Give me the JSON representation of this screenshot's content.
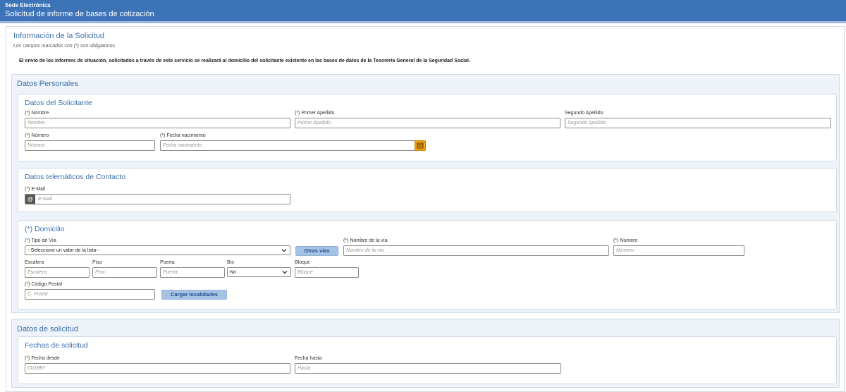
{
  "header": {
    "site": "Sede Electrónica",
    "title": "Solicitud de informe de bases de cotización"
  },
  "info": {
    "title": "Información de la Solicitud",
    "required_note": "Los campos marcados con (*) son obligatorios.",
    "notice": "El envío de los informes de situación, solicitados a través de este servicio se realizará al domicilio del solicitante existente en las bases de datos de la Tesorería General de la Seguridad Social."
  },
  "personal": {
    "section_title": "Datos Personales",
    "solicitante": {
      "title": "Datos del Solicitante",
      "nombre": {
        "label": "(*) Nombre",
        "placeholder": "Nombre"
      },
      "primer_apellido": {
        "label": "(*) Primer Apellido",
        "placeholder": "Primer Apellido"
      },
      "segundo_apellido": {
        "label": "Segundo Apellido",
        "placeholder": "Segundo Apellido"
      },
      "numero": {
        "label": "(*) Número",
        "placeholder": "Número"
      },
      "fecha_nacimiento": {
        "label": "(*) Fecha nacimiento",
        "placeholder": "Fecha nacimiento"
      },
      "calendar_icon": "calendar-icon"
    },
    "contacto": {
      "title": "Datos telemáticos de Contacto",
      "email": {
        "label": "(*) E-Mail",
        "placeholder": "E-Mail",
        "addon": "@"
      }
    },
    "domicilio": {
      "title": "(*) Domicilio",
      "tipo_via": {
        "label": "(*) Tipo de Vía",
        "value": "--Seleccione un valor de la lista--"
      },
      "otras_vias_button": "Otras vías",
      "nombre_via": {
        "label": "(*) Nombre de la vía",
        "placeholder": "Nombre de la vía"
      },
      "numero": {
        "label": "(*) Número",
        "placeholder": "Número"
      },
      "escalera": {
        "label": "Escalera",
        "placeholder": "Escalera"
      },
      "piso": {
        "label": "Piso",
        "placeholder": "Piso"
      },
      "puerta": {
        "label": "Puerta",
        "placeholder": "Puerta"
      },
      "bis": {
        "label": "Bis",
        "value": "No"
      },
      "bloque": {
        "label": "Bloque",
        "placeholder": "Bloque"
      },
      "codigo_postal": {
        "label": "(*) Código Postal",
        "placeholder": "C. Postal"
      },
      "cargar_localidades_button": "Cargar localidades"
    }
  },
  "solicitud": {
    "section_title": "Datos de solicitud",
    "fechas": {
      "title": "Fechas de solicitud",
      "desde": {
        "label": "(*) Fecha desde",
        "value": "01/1997"
      },
      "hasta": {
        "label": "Fecha hasta",
        "placeholder": "Hasta"
      }
    }
  }
}
